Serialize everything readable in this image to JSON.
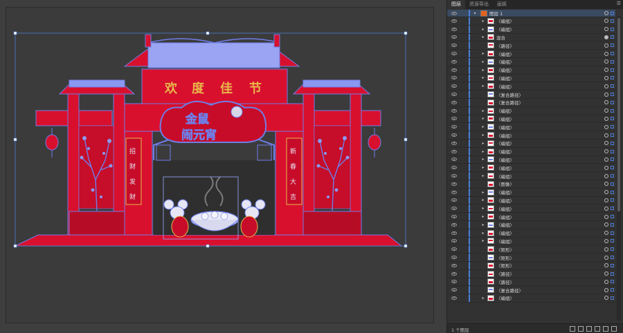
{
  "panel": {
    "tabs": [
      "图层",
      "资源导出",
      "画板"
    ],
    "active_tab": "图层",
    "menu_icon": "hamburger-menu-icon",
    "footer_text": "1 个图层",
    "top_layer": {
      "label": "图层 1",
      "expanded": true
    }
  },
  "layers": [
    {
      "label": "〈编组〉",
      "expandable": true
    },
    {
      "label": "〈编组〉",
      "expandable": true
    },
    {
      "label": "混合",
      "expandable": true,
      "filled_target": true
    },
    {
      "label": "〈路径〉",
      "expandable": false
    },
    {
      "label": "〈编组〉",
      "expandable": true
    },
    {
      "label": "〈编组〉",
      "expandable": true
    },
    {
      "label": "〈编组〉",
      "expandable": true
    },
    {
      "label": "〈编组〉",
      "expandable": true
    },
    {
      "label": "〈编组〉",
      "expandable": true
    },
    {
      "label": "〈复合路径〉",
      "expandable": false
    },
    {
      "label": "〈复合路径〉",
      "expandable": false
    },
    {
      "label": "〈编组〉",
      "expandable": true
    },
    {
      "label": "〈编组〉",
      "expandable": true
    },
    {
      "label": "〈编组〉",
      "expandable": true
    },
    {
      "label": "〈编组〉",
      "expandable": true
    },
    {
      "label": "〈编组〉",
      "expandable": true
    },
    {
      "label": "〈编组〉",
      "expandable": true
    },
    {
      "label": "〈编组〉",
      "expandable": true
    },
    {
      "label": "〈编组〉",
      "expandable": true
    },
    {
      "label": "〈编组〉",
      "expandable": true
    },
    {
      "label": "〈图像〉",
      "expandable": false
    },
    {
      "label": "〈编组〉",
      "expandable": true
    },
    {
      "label": "〈编组〉",
      "expandable": true
    },
    {
      "label": "〈编组〉",
      "expandable": true
    },
    {
      "label": "〈编组〉",
      "expandable": true
    },
    {
      "label": "〈编组〉",
      "expandable": true
    },
    {
      "label": "〈编组〉",
      "expandable": true
    },
    {
      "label": "〈编组〉",
      "expandable": true
    },
    {
      "label": "〈矩形〉",
      "expandable": false
    },
    {
      "label": "〈矩形〉",
      "expandable": false
    },
    {
      "label": "〈矩形〉",
      "expandable": false
    },
    {
      "label": "〈路径〉",
      "expandable": false
    },
    {
      "label": "〈路径〉",
      "expandable": false
    },
    {
      "label": "〈复合路径〉",
      "expandable": false
    },
    {
      "label": "〈编组〉",
      "expandable": true
    }
  ],
  "artwork": {
    "top_banner": [
      "欢",
      "度",
      "佳",
      "节"
    ],
    "center_plaque_line1": "金鼠",
    "center_plaque_line2": "闹元宵",
    "left_couplet": [
      "招",
      "财",
      "发",
      "财"
    ],
    "right_couplet": [
      "新",
      "春",
      "大",
      "吉"
    ],
    "colors": {
      "red": "#d8102e",
      "dark_red": "#a3081f",
      "blue": "#6f7ee8",
      "gold": "#e9b64a",
      "selection": "#4d7fd6"
    }
  }
}
